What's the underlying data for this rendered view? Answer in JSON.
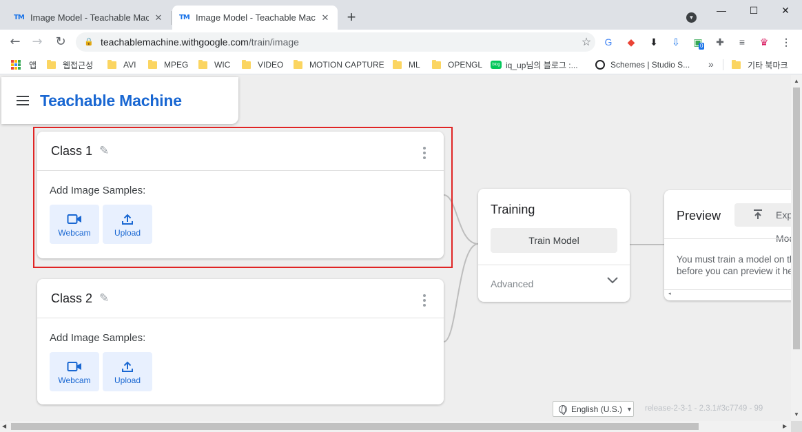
{
  "browser": {
    "tabs": [
      {
        "favicon": "TM",
        "title": "Image Model - Teachable Machine",
        "active": false
      },
      {
        "favicon": "TM",
        "title": "Image Model - Teachable Machine",
        "active": true
      }
    ],
    "tab_close": "✕",
    "new_tab": "+",
    "window": {
      "minimize": "—",
      "maximize": "☐",
      "close": "✕"
    },
    "url_host": "teachablemachine.withgoogle.com",
    "url_path": "/train/image",
    "nav_icons": {
      "back": "←",
      "forward": "→",
      "reload": "↻",
      "lock": "🔒",
      "star": "☆"
    },
    "bookmarks": [
      {
        "label": "앱",
        "icon": "apps-grid-icon"
      },
      {
        "label": "웹접근성",
        "icon": "folder-icon"
      },
      {
        "label": "AVI",
        "icon": "folder-icon"
      },
      {
        "label": "MPEG",
        "icon": "folder-icon"
      },
      {
        "label": "WIC",
        "icon": "folder-icon"
      },
      {
        "label": "VIDEO",
        "icon": "folder-icon"
      },
      {
        "label": "MOTION CAPTURE",
        "icon": "folder-icon"
      },
      {
        "label": "ML",
        "icon": "folder-icon"
      },
      {
        "label": "OPENGL",
        "icon": "folder-icon"
      },
      {
        "label": "iq_up님의 블로그 :...",
        "icon": "blog-icon"
      },
      {
        "label": "Schemes | Studio S...",
        "icon": "schemes-icon"
      }
    ],
    "bookmarks_more": "»",
    "other_bookmarks": "기타 북마크",
    "blog_icon_text": "blog",
    "extension_badge": "0"
  },
  "app": {
    "brand": "Teachable Machine",
    "classes": [
      {
        "title": "Class 1",
        "samples_label": "Add Image Samples:",
        "webcam_label": "Webcam",
        "upload_label": "Upload"
      },
      {
        "title": "Class 2",
        "samples_label": "Add Image Samples:",
        "webcam_label": "Webcam",
        "upload_label": "Upload"
      }
    ],
    "training": {
      "title": "Training",
      "button": "Train Model",
      "advanced": "Advanced"
    },
    "preview": {
      "title": "Preview",
      "export": "Export Model",
      "message": "You must train a model on the left before you can preview it here."
    },
    "language": "English (U.S.)",
    "release": "release-2-3-1 - 2.3.1#3c7749 - 99",
    "colors": {
      "brand": "#1967d2",
      "highlight": "#e02424",
      "button_bg": "#e8f0fe"
    }
  }
}
